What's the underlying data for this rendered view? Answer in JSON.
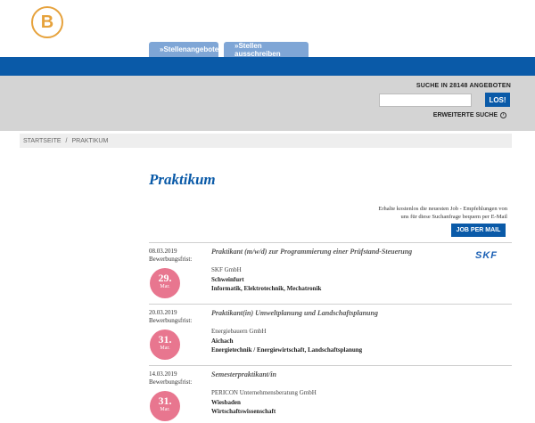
{
  "logo": {
    "letter": "B",
    "color": "#e6a23c"
  },
  "tabs": [
    {
      "label": "»Stellenangebote"
    },
    {
      "label": "»Stellen ausschreiben"
    }
  ],
  "search": {
    "count_label": "SUCHE IN 28148 ANGEBOTEN",
    "input_value": "",
    "button_label": "LOS!",
    "advanced_label": "ERWEITERTE SUCHE",
    "advanced_icon": "chevron-circle-icon"
  },
  "breadcrumb": {
    "home": "STARTSEITE",
    "separator": "/",
    "current": "PRAKTIKUM"
  },
  "page": {
    "title": "Praktikum",
    "email_promo_line1": "Erhalte kostenlos die neuesten Job - Empfehlungen von",
    "email_promo_line2": "uns für diese Suchanfrage bequem per E-Mail",
    "email_button": "JOB PER MAIL"
  },
  "jobs": [
    {
      "date": "08.03.2019",
      "deadline_label": "Bewerbungsfrist:",
      "deadline_day": "29.",
      "deadline_month": "Mar.",
      "title": "Praktikant (m/w/d) zur Programmierung einer Prüfstand-Steuerung",
      "company": "SKF GmbH",
      "city": "Schweinfurt",
      "fields": "Informatik, Elektrotechnik, Mechatronik",
      "logo_text": "SKF"
    },
    {
      "date": "20.03.2019",
      "deadline_label": "Bewerbungsfrist:",
      "deadline_day": "31.",
      "deadline_month": "Mar.",
      "title": "Praktikant(in) Umweltplanung und Landschaftsplanung",
      "company": "Energiebauern GmbH",
      "city": "Aichach",
      "fields": "Energietechnik / Energiewirtschaft, Landschaftsplanung"
    },
    {
      "date": "14.03.2019",
      "deadline_label": "Bewerbungsfrist:",
      "deadline_day": "31.",
      "deadline_month": "Mar.",
      "title": "Semesterpraktikant/in",
      "company": "PERICON Unternehmensberatung GmbH",
      "city": "Wiesbaden",
      "fields": "Wirtschaftswissenschaft"
    }
  ],
  "colors": {
    "brand_blue": "#0a5aa8",
    "tab_blue": "#7fa6d6",
    "badge_pink": "#e8768f",
    "search_band": "#d4d4d4"
  }
}
